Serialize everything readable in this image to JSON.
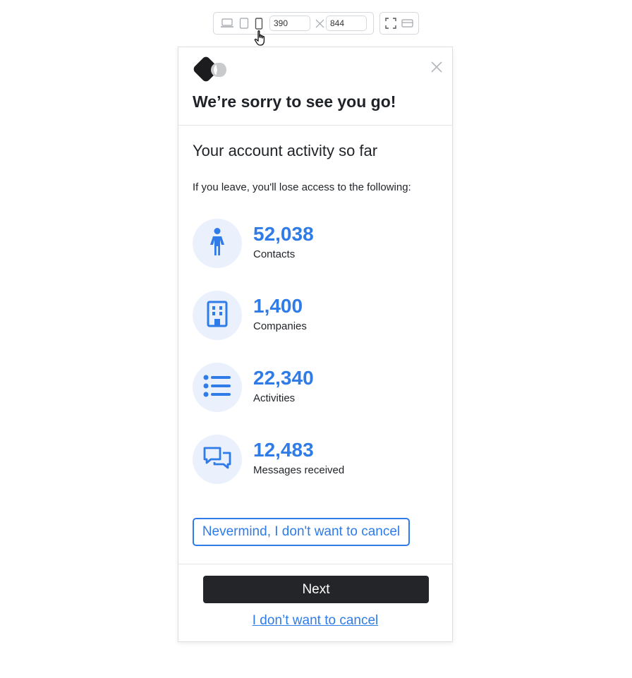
{
  "toolbar": {
    "width_value": "390",
    "height_value": "844",
    "icons": [
      "laptop-icon",
      "tablet-icon",
      "mobile-icon",
      "dimension-x-icon",
      "fullscreen-icon",
      "panel-icon"
    ]
  },
  "modal": {
    "title": "We’re sorry to see you go!",
    "subtitle": "Your account activity so far",
    "intro": "If you leave, you'll lose access to the following:",
    "stats": [
      {
        "icon": "person-icon",
        "value": "52,038",
        "label": "Contacts"
      },
      {
        "icon": "building-icon",
        "value": "1,400",
        "label": "Companies"
      },
      {
        "icon": "list-icon",
        "value": "22,340",
        "label": "Activities"
      },
      {
        "icon": "chat-bubbles-icon",
        "value": "12,483",
        "label": "Messages received"
      }
    ],
    "nevermind_label": "Nevermind, I don't want to cancel",
    "next_label": "Next",
    "dont_cancel_label": "I don’t want to cancel"
  },
  "colors": {
    "accent": "#2f7be8",
    "icon_bg": "#eaf1fd",
    "primary_button": "#232528"
  }
}
